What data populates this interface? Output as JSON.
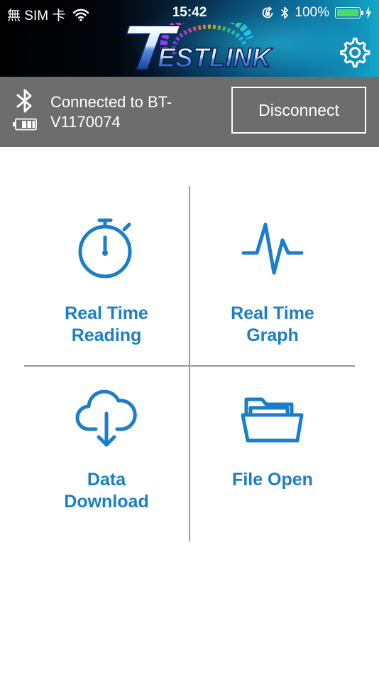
{
  "status_bar": {
    "carrier": "無 SIM 卡",
    "time": "15:42",
    "battery_percent": "100%"
  },
  "header": {
    "logo_text": "TESTLINK",
    "settings_icon": "gear-icon"
  },
  "connection": {
    "status_line1": "Connected to BT-",
    "status_line2": "V1170074",
    "disconnect_label": "Disconnect",
    "bluetooth_icon": "bluetooth-icon",
    "battery_icon": "battery-icon"
  },
  "tiles": [
    {
      "line1": "Real Time",
      "line2": "Reading",
      "icon": "stopwatch-icon"
    },
    {
      "line1": "Real Time",
      "line2": "Graph",
      "icon": "pulse-graph-icon"
    },
    {
      "line1": "Data",
      "line2": "Download",
      "icon": "cloud-download-icon"
    },
    {
      "line1": "File Open",
      "line2": "",
      "icon": "folder-open-icon"
    }
  ],
  "colors": {
    "accent_blue": "#1a7ec8",
    "connection_bar": "#6d6d6d",
    "battery_green": "#4cd964"
  }
}
